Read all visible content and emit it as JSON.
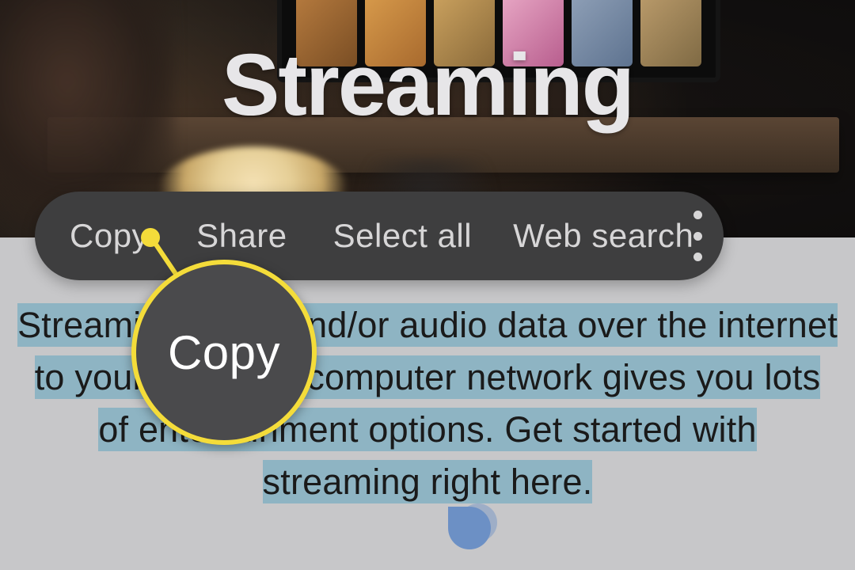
{
  "hero": {
    "title": "Streaming"
  },
  "context_menu": {
    "items": [
      "Copy",
      "Share",
      "Select all",
      "Web search"
    ]
  },
  "callout": {
    "label": "Copy"
  },
  "body": {
    "text": "Streaming video and/or audio data over the internet to your phone or computer network gives you lots of entertainment options. Get started with streaming right here."
  },
  "colors": {
    "highlight": "#8eb4c3",
    "callout_ring": "#f4dc3a",
    "menu_bg": "#3e3e3f"
  }
}
